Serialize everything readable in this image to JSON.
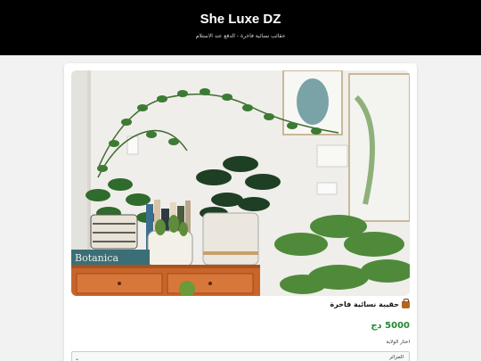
{
  "header": {
    "brand": "She Luxe DZ",
    "tagline": "حقائب نسائية فاخرة - الدفع عند الاستلام"
  },
  "product": {
    "image_icon": "plants-shelf-photo",
    "title_icon": "handbag-icon",
    "title": "حقيبة نسائية فاخرة",
    "price": "5000 دج",
    "price_color": "#1e8a2e"
  },
  "form": {
    "wilaya_label": "اختار الولاية",
    "wilaya_selected": "الجزائر"
  }
}
